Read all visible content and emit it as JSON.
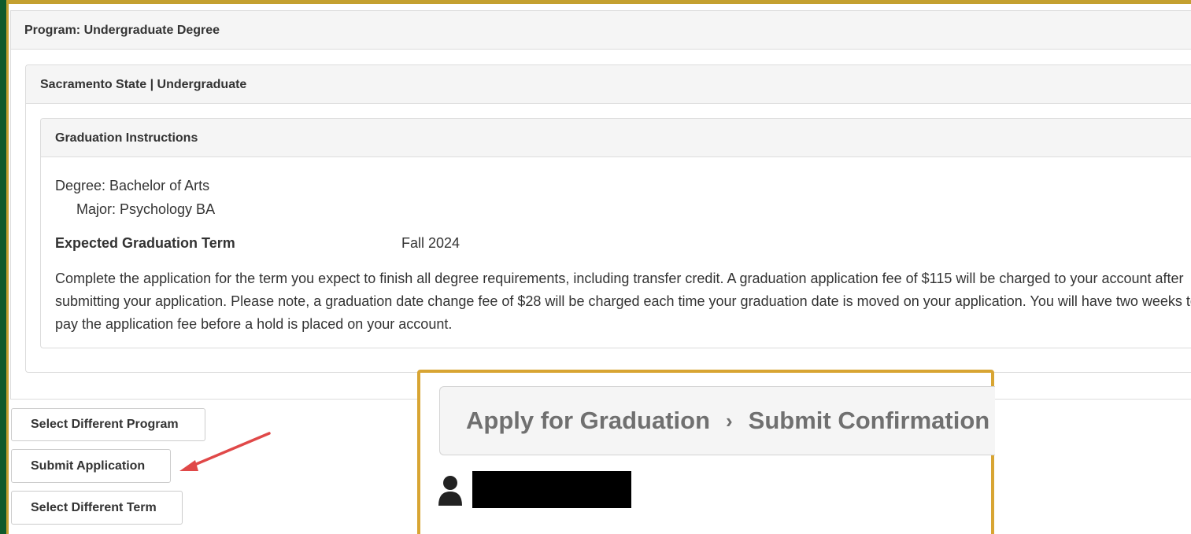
{
  "program": {
    "heading": "Program: Undergraduate Degree",
    "institution_heading": "Sacramento State | Undergraduate",
    "instructions_heading": "Graduation Instructions",
    "degree": "Degree: Bachelor of Arts",
    "major": "Major: Psychology BA",
    "term_label": "Expected Graduation Term",
    "term_value": "Fall 2024",
    "instructions_text": "Complete the application for the term you expect to finish all degree requirements, including transfer credit. A graduation application fee of $115 will be charged to your account after submitting your application.  Please note, a graduation date change fee of $28 will be charged each time your graduation date is moved on your application. You will have two weeks to pay the application fee before a hold is placed on your account."
  },
  "actions": {
    "select_program": "Select Different Program",
    "submit_application": "Submit Application",
    "select_term": "Select Different Term"
  },
  "callout": {
    "breadcrumb_parent": "Apply for Graduation",
    "breadcrumb_separator": "›",
    "breadcrumb_current": "Submit Confirmation",
    "user_icon": "user-icon"
  },
  "colors": {
    "frame_green": "#0f5a2c",
    "frame_gold": "#c4a030",
    "callout_border": "#d8a533",
    "arrow_red": "#e04848"
  }
}
